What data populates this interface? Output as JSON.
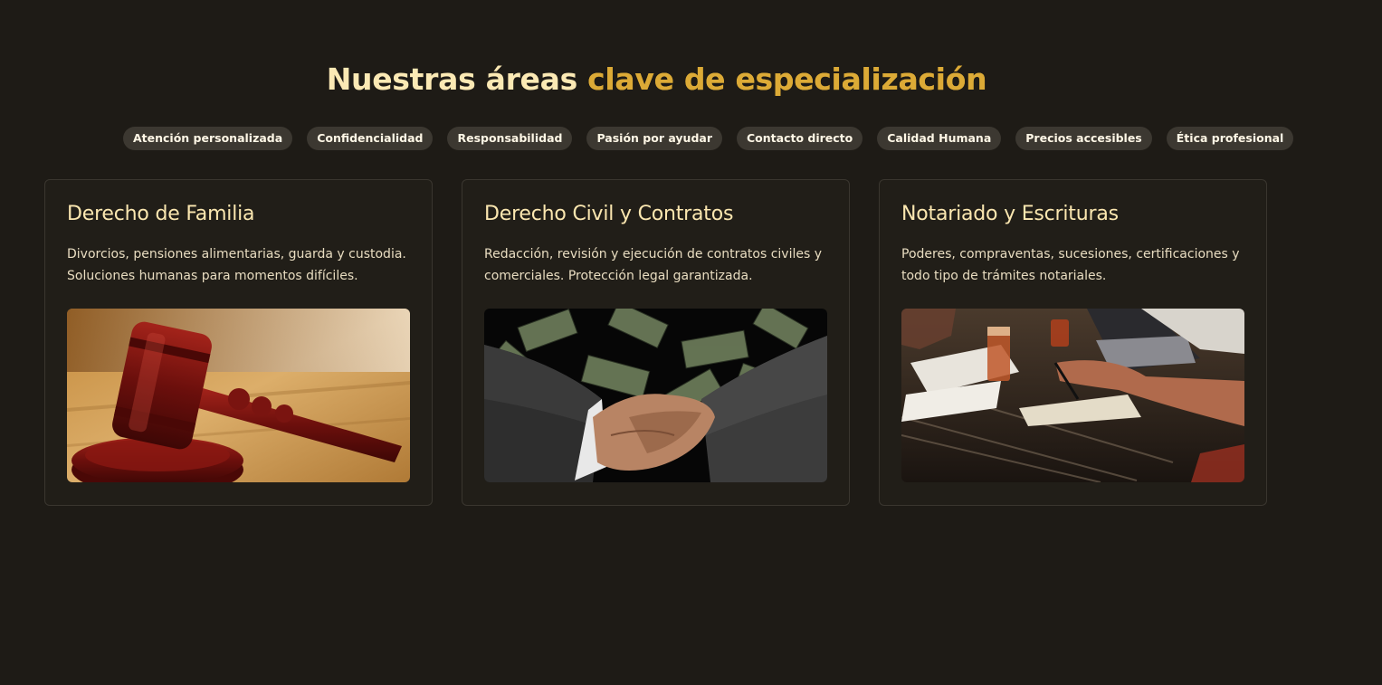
{
  "heading": {
    "plain": "Nuestras áreas",
    "accent": "clave de especialización"
  },
  "values": [
    "Atención personalizada",
    "Confidencialidad",
    "Responsabilidad",
    "Pasión por ayudar",
    "Contacto directo",
    "Calidad Humana",
    "Precios accesibles",
    "Ética profesional"
  ],
  "cards": [
    {
      "title": "Derecho de Familia",
      "description": "Divorcios, pensiones alimentarias, guarda y custodia. Soluciones humanas para momentos difíciles.",
      "image": "gavel-photo"
    },
    {
      "title": "Derecho Civil y Contratos",
      "description": "Redacción, revisión y ejecución de contratos civiles y comerciales. Protección legal garantizada.",
      "image": "handshake-money-photo"
    },
    {
      "title": "Notariado y Escrituras",
      "description": "Poderes, compraventas, sucesiones, certificaciones y todo tipo de trámites notariales.",
      "image": "desk-documents-photo"
    }
  ],
  "colors": {
    "background": "#1e1b16",
    "accent": "#dcaa36",
    "title": "#fbe7b0",
    "pill": "#3c3831"
  }
}
